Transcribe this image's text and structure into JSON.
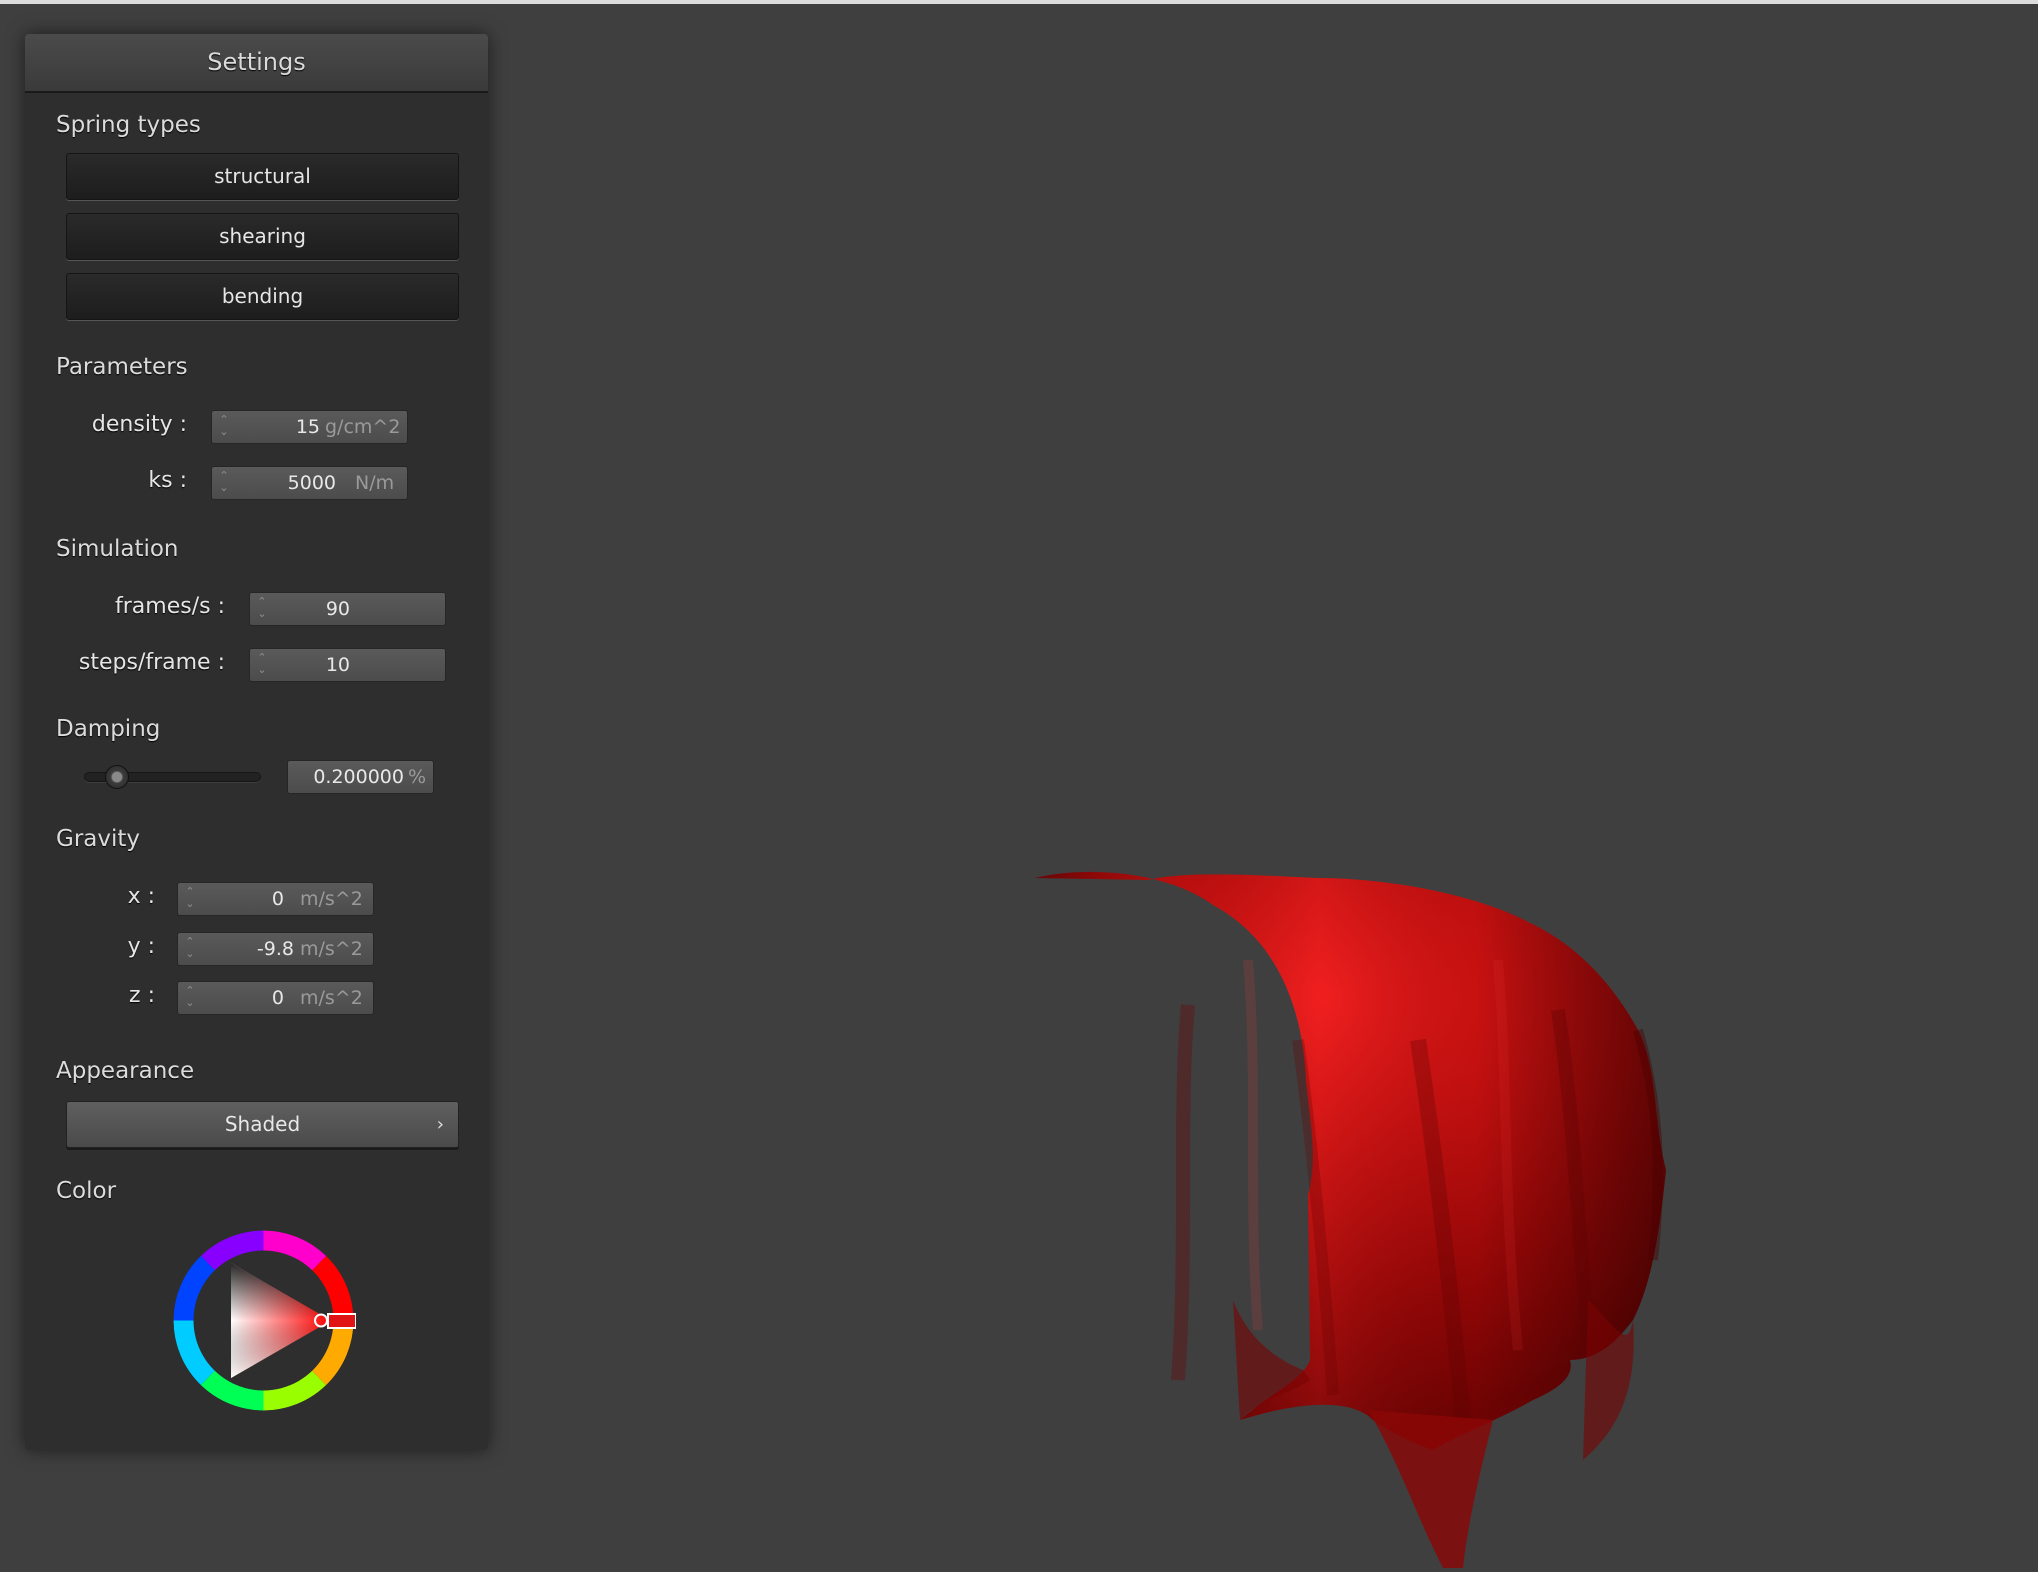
{
  "panel": {
    "title": "Settings",
    "spring_types": {
      "heading": "Spring types",
      "buttons": [
        "structural",
        "shearing",
        "bending"
      ]
    },
    "parameters": {
      "heading": "Parameters",
      "density": {
        "label": "density :",
        "value": "15",
        "unit": "g/cm^2"
      },
      "ks": {
        "label": "ks :",
        "value": "5000",
        "unit": "N/m"
      }
    },
    "simulation": {
      "heading": "Simulation",
      "fps": {
        "label": "frames/s :",
        "value": "90"
      },
      "steps": {
        "label": "steps/frame :",
        "value": "10"
      }
    },
    "damping": {
      "heading": "Damping",
      "value": "0.200000",
      "unit": "%",
      "slider_fraction": 0.2
    },
    "gravity": {
      "heading": "Gravity",
      "x": {
        "label": "x :",
        "value": "0",
        "unit": "m/s^2"
      },
      "y": {
        "label": "y :",
        "value": "-9.8",
        "unit": "m/s^2"
      },
      "z": {
        "label": "z :",
        "value": "0",
        "unit": "m/s^2"
      }
    },
    "appearance": {
      "heading": "Appearance",
      "selected": "Shaded"
    },
    "color": {
      "heading": "Color",
      "selected_hex": "#e01414"
    }
  },
  "colors": {
    "background": "#3f3f3f",
    "panel": "#2e2e2e",
    "cloth": "#d01010"
  },
  "icons": {
    "spinner": "up-down-arrows",
    "combo": "chevron-right-icon"
  }
}
